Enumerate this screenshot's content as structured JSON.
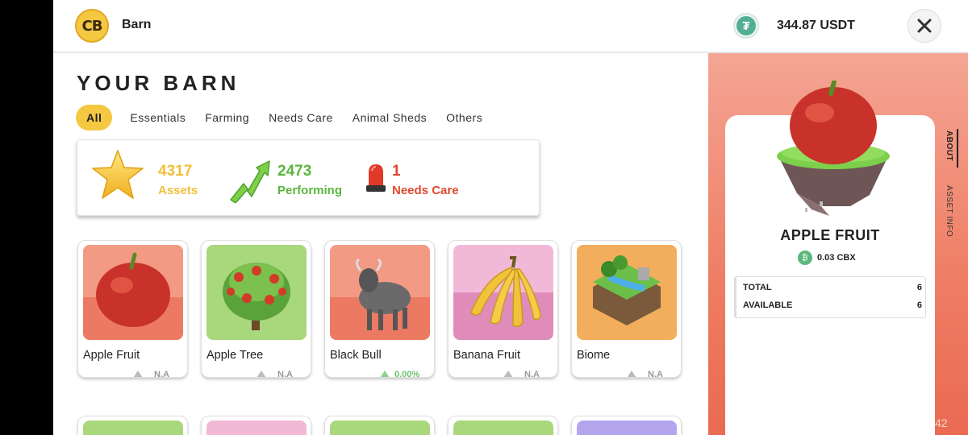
{
  "header": {
    "logo_text": "CB",
    "app_name": "Barn",
    "currency_icon": "tether-icon",
    "balance": "344.87 USDT",
    "close_icon": "close-icon"
  },
  "page_title": "YOUR BARN",
  "tabs": [
    {
      "label": "All",
      "active": true
    },
    {
      "label": "Essentials",
      "active": false
    },
    {
      "label": "Farming",
      "active": false
    },
    {
      "label": "Needs Care",
      "active": false
    },
    {
      "label": "Animal Sheds",
      "active": false
    },
    {
      "label": "Others",
      "active": false
    }
  ],
  "summary": {
    "assets": {
      "value": "4317",
      "label": "Assets",
      "icon": "star-icon",
      "color": "#f0bf3a"
    },
    "performing": {
      "value": "2473",
      "label": "Performing",
      "icon": "trend-up-icon",
      "color": "#5ab63e"
    },
    "needs_care": {
      "value": "1",
      "label": "Needs Care",
      "icon": "siren-icon",
      "color": "#e0472f"
    }
  },
  "assets": [
    {
      "name": "Apple Fruit",
      "value": "N.A",
      "trend": "neutral",
      "bg": "#f08a73"
    },
    {
      "name": "Apple Tree",
      "value": "N.A",
      "trend": "neutral",
      "bg": "#a8d77c"
    },
    {
      "name": "Black Bull",
      "value": "0.00%",
      "trend": "up",
      "bg": "#f08a73"
    },
    {
      "name": "Banana Fruit",
      "value": "N.A",
      "trend": "neutral",
      "bg": "#e597c4"
    },
    {
      "name": "Biome",
      "value": "N.A",
      "trend": "neutral",
      "bg": "#f2ae5c"
    }
  ],
  "detail": {
    "tabs": [
      "ABOUT",
      "ASSET INFO"
    ],
    "name": "APPLE FRUIT",
    "price": "0.03 CBX",
    "price_icon": "cbx-coin-icon",
    "rows": [
      {
        "label": "TOTAL",
        "value": "6"
      },
      {
        "label": "AVAILABLE",
        "value": "6"
      }
    ]
  },
  "corner_number": "42",
  "colors": {
    "accent_yellow": "#f5c842",
    "side_panel": "#ee7d63"
  }
}
